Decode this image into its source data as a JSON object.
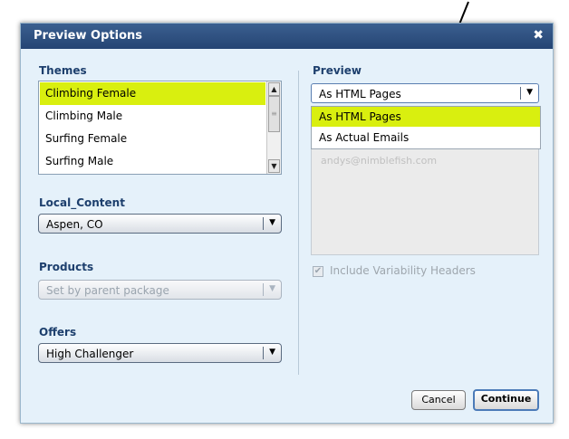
{
  "dialog": {
    "title": "Preview Options",
    "close_glyph": "✖"
  },
  "themes": {
    "label": "Themes",
    "items": [
      "Climbing Female",
      "Climbing Male",
      "Surfing Female",
      "Surfing Male"
    ],
    "selected_index": 0
  },
  "local_content": {
    "label": "Local_Content",
    "value": "Aspen, CO"
  },
  "products": {
    "label": "Products",
    "value": "Set by parent package"
  },
  "offers": {
    "label": "Offers",
    "value": "High Challenger"
  },
  "preview": {
    "label": "Preview",
    "value": "As HTML Pages",
    "options": [
      "As HTML Pages",
      "As Actual Emails"
    ],
    "highlighted_index": 0
  },
  "email": {
    "placeholder": "andys@nimblefish.com"
  },
  "variability": {
    "label": "Include Variability Headers",
    "checked": true
  },
  "buttons": {
    "cancel": "Cancel",
    "continue": "Continue"
  },
  "colors": {
    "highlight": "#d9ef0f",
    "titlebar": "#2c4d7e",
    "section_label": "#1d3f6d"
  },
  "icons": {
    "dropdown": "chevron-down-icon",
    "close": "close-icon",
    "arrow": "annotation-arrow-icon"
  }
}
